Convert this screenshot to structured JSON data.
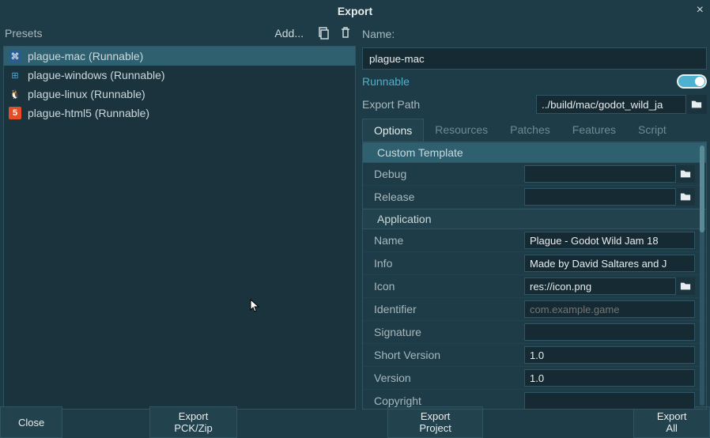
{
  "window": {
    "title": "Export",
    "close": "×"
  },
  "presets": {
    "label": "Presets",
    "add_label": "Add...",
    "items": [
      {
        "label": "plague-mac (Runnable)",
        "icon": "mac",
        "selected": true
      },
      {
        "label": "plague-windows (Runnable)",
        "icon": "win",
        "selected": false
      },
      {
        "label": "plague-linux (Runnable)",
        "icon": "linux",
        "selected": false
      },
      {
        "label": "plague-html5 (Runnable)",
        "icon": "html5",
        "selected": false
      }
    ]
  },
  "details": {
    "name_label": "Name:",
    "name_value": "plague-mac",
    "runnable_label": "Runnable",
    "runnable_on": true,
    "export_path_label": "Export Path",
    "export_path_value": "../build/mac/godot_wild_ja"
  },
  "tabs": {
    "items": [
      "Options",
      "Resources",
      "Patches",
      "Features",
      "Script"
    ],
    "active": 0
  },
  "options": {
    "custom_template_hdr": "Custom Template",
    "debug_label": "Debug",
    "debug_value": "",
    "release_label": "Release",
    "release_value": "",
    "application_hdr": "Application",
    "name_label": "Name",
    "name_value": "Plague - Godot Wild Jam 18",
    "info_label": "Info",
    "info_value": "Made by David Saltares and J",
    "icon_label": "Icon",
    "icon_value": "res://icon.png",
    "identifier_label": "Identifier",
    "identifier_placeholder": "com.example.game",
    "signature_label": "Signature",
    "signature_value": "",
    "short_version_label": "Short Version",
    "short_version_value": "1.0",
    "version_label": "Version",
    "version_value": "1.0",
    "copyright_label": "Copyright",
    "copyright_value": ""
  },
  "footer": {
    "close": "Close",
    "export_pck": "Export PCK/Zip",
    "export_project": "Export Project",
    "export_all": "Export All"
  }
}
